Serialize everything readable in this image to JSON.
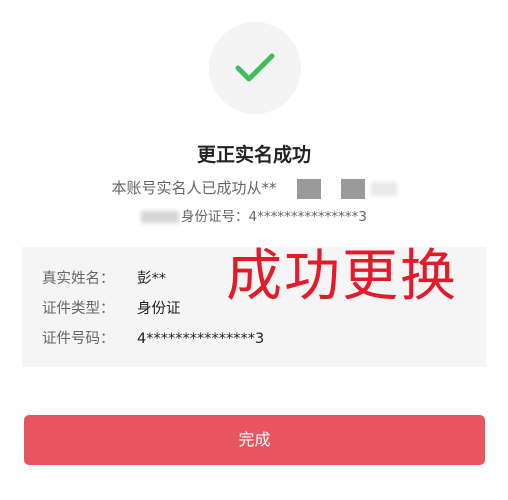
{
  "result": {
    "title": "更正实名成功",
    "description": "本账号实名人已成功从**",
    "id_line": "身份证号：4***************3"
  },
  "details": {
    "name_label": "真实姓名：",
    "name_value": "彭**",
    "doc_type_label": "证件类型：",
    "doc_type_value": "身份证",
    "doc_number_label": "证件号码：",
    "doc_number_value": "4***************3"
  },
  "overlay": {
    "text": "成功更换"
  },
  "actions": {
    "done_label": "完成"
  },
  "colors": {
    "check": "#3dbd5c",
    "button": "#e85460",
    "overlay_text": "#e21b2b"
  }
}
